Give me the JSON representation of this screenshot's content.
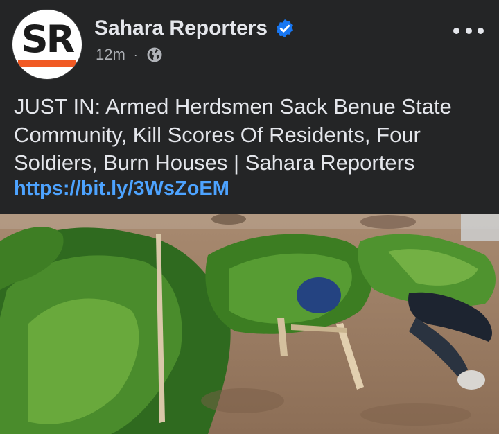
{
  "post": {
    "page_name": "Sahara Reporters",
    "avatar_monogram": "SR",
    "time": "12m",
    "separator": "·",
    "audience_icon": "globe-icon",
    "verified_icon": "verified-badge-icon",
    "more_icon": "more-options-icon",
    "text": "JUST IN: Armed Herdsmen Sack Benue State Community, Kill Scores Of Residents, Four Soldiers, Burn Houses | Sahara Reporters",
    "link": "https://bit.ly/3WsZoEM",
    "image": "news-photo"
  },
  "colors": {
    "background": "#242526",
    "text": "#e4e6eb",
    "muted": "#b0b3b8",
    "link": "#4da3ff",
    "verified": "#1877f2",
    "brand_accent": "#f15a24"
  }
}
